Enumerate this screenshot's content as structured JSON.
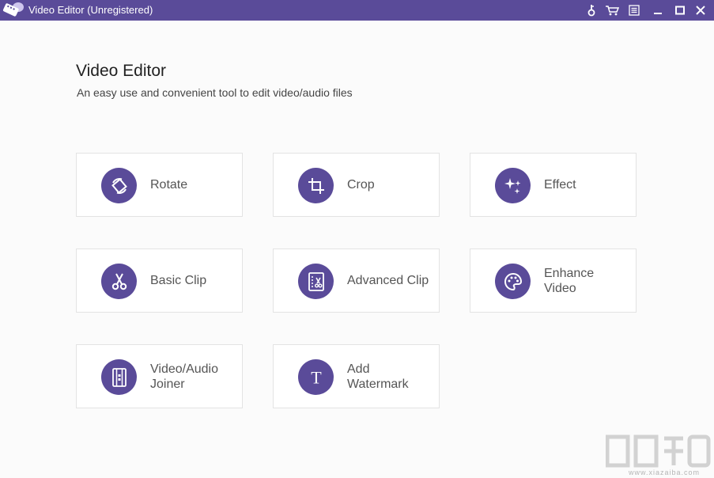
{
  "window": {
    "title": "Video Editor (Unregistered)",
    "controls": [
      "key-icon",
      "cart-icon",
      "menu-icon",
      "minimize-icon",
      "maximize-icon",
      "close-icon"
    ]
  },
  "header": {
    "title": "Video Editor",
    "subtitle": "An easy use and convenient tool to edit video/audio files"
  },
  "tools": [
    {
      "line1": "Rotate",
      "line2": "",
      "icon": "rotate-icon"
    },
    {
      "line1": "Crop",
      "line2": "",
      "icon": "crop-icon"
    },
    {
      "line1": "Effect",
      "line2": "",
      "icon": "sparkle-icon"
    },
    {
      "line1": "Basic Clip",
      "line2": "",
      "icon": "scissors-icon"
    },
    {
      "line1": "Advanced Clip",
      "line2": "",
      "icon": "advanced-clip-icon"
    },
    {
      "line1": "Enhance",
      "line2": "Video",
      "icon": "palette-icon"
    },
    {
      "line1": "Video/Audio",
      "line2": "Joiner",
      "icon": "film-icon"
    },
    {
      "line1": "Add",
      "line2": "Watermark",
      "icon": "text-t-icon"
    }
  ],
  "watermark": {
    "text": "www.xiazaiba.com"
  },
  "colors": {
    "accent": "#5a4b99",
    "background": "#fbfbfb",
    "card_border": "#e3e3e3"
  }
}
